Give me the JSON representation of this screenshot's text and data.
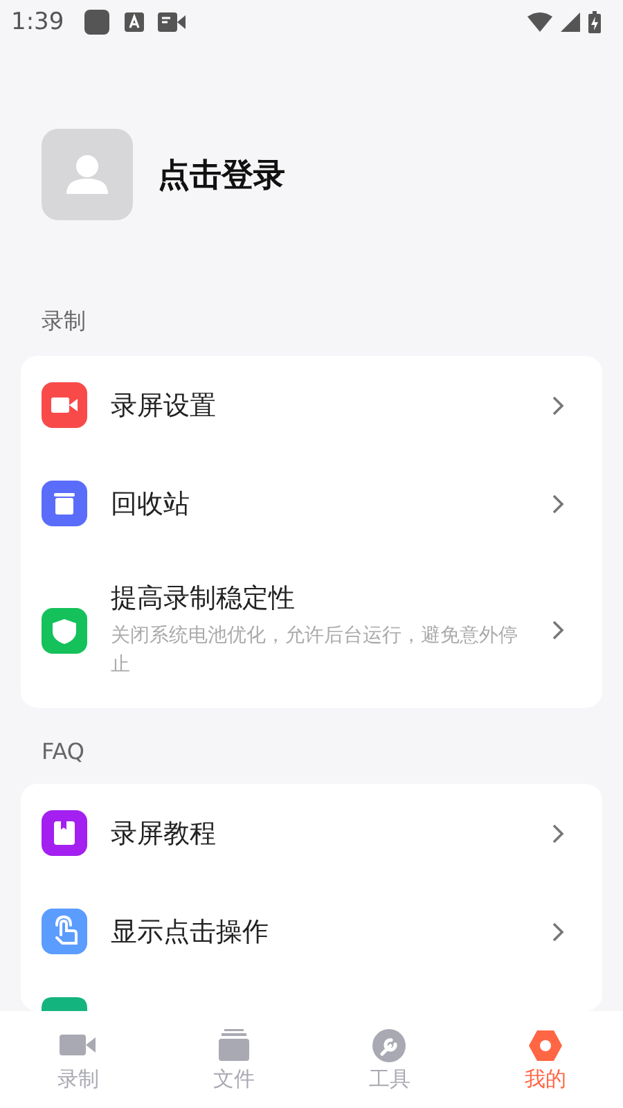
{
  "status_bar": {
    "time": "1:39"
  },
  "profile": {
    "login_label": "点击登录"
  },
  "sections": [
    {
      "title": "录制",
      "items": [
        {
          "kind": "video",
          "color": "#f94a4a",
          "title": "录屏设置"
        },
        {
          "kind": "trash",
          "color": "#5a6cfa",
          "title": "回收站"
        },
        {
          "kind": "shield",
          "color": "#14c15a",
          "title": "提高录制稳定性",
          "subtitle": "关闭系统电池优化，允许后台运行，避免意外停止"
        }
      ]
    },
    {
      "title": "FAQ",
      "items": [
        {
          "kind": "book",
          "color": "#a320f0",
          "title": "录屏教程"
        },
        {
          "kind": "hand",
          "color": "#5b9cff",
          "title": "显示点击操作"
        },
        {
          "kind": "partial",
          "color": "#14b47e"
        }
      ]
    }
  ],
  "tabs": [
    {
      "kind": "camera",
      "label": "录制",
      "selected": false
    },
    {
      "kind": "folder",
      "label": "文件",
      "selected": false
    },
    {
      "kind": "wrench",
      "label": "工具",
      "selected": false
    },
    {
      "kind": "hex",
      "label": "我的",
      "selected": true
    }
  ]
}
